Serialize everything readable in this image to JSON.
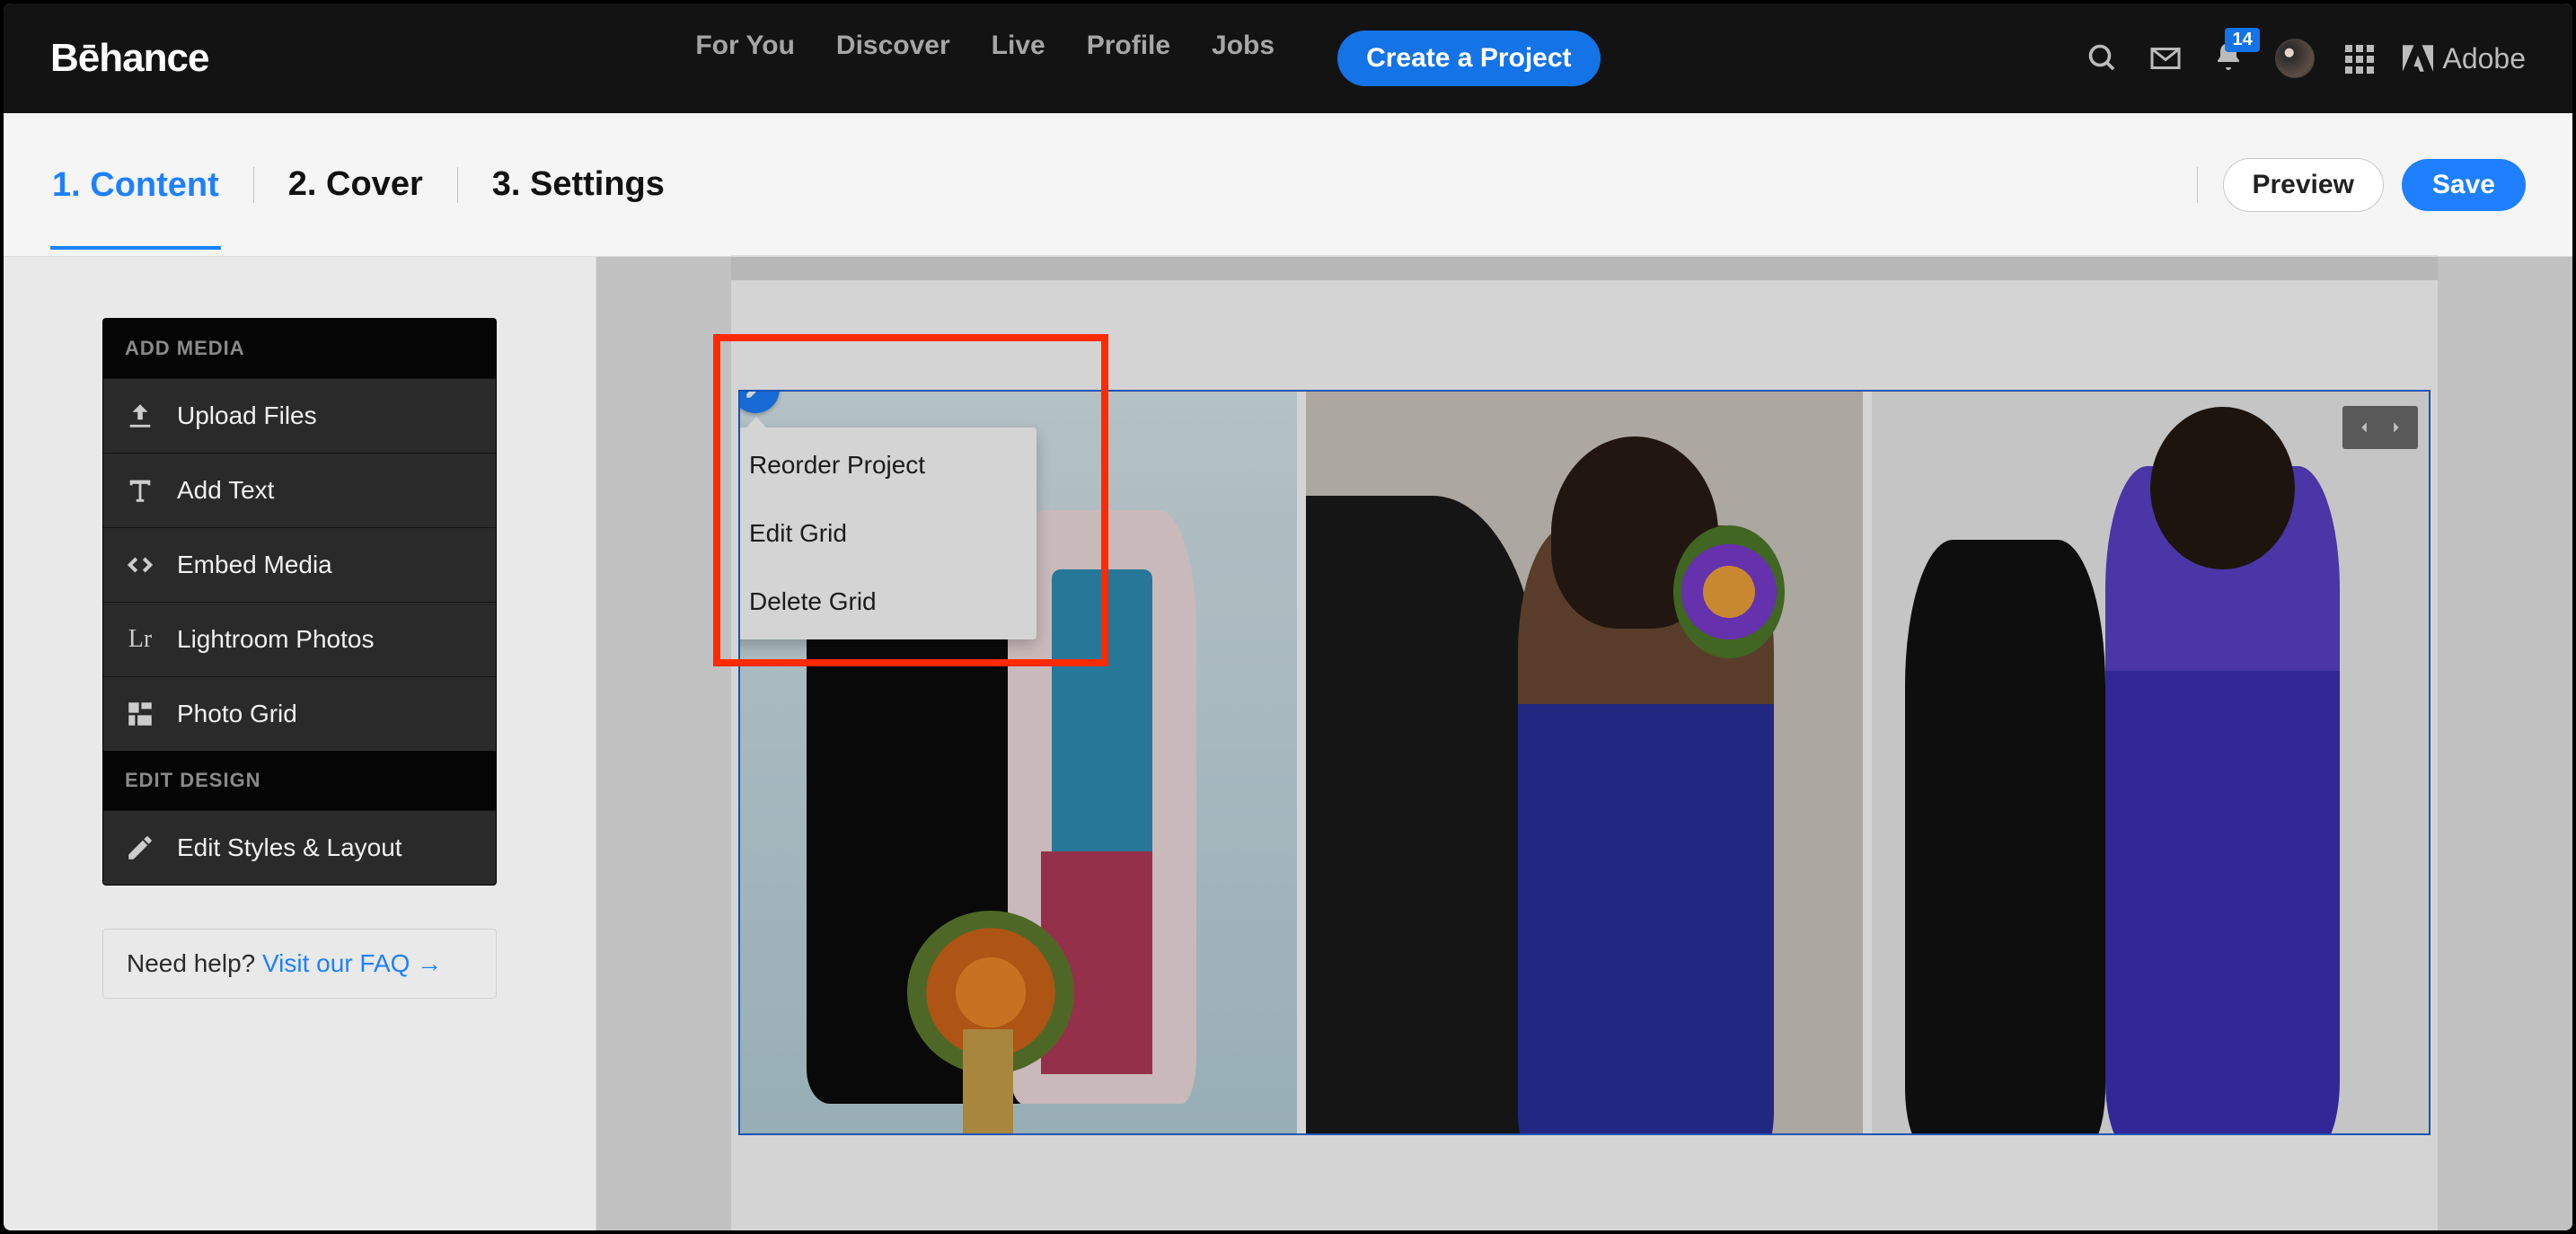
{
  "topnav": {
    "logo": "Bēhance",
    "links": [
      "For You",
      "Discover",
      "Live",
      "Profile",
      "Jobs"
    ],
    "create_label": "Create a Project",
    "badge_count": "14",
    "adobe_label": "Adobe"
  },
  "subbar": {
    "steps": [
      "1. Content",
      "2. Cover",
      "3. Settings"
    ],
    "active_index": 0,
    "preview_label": "Preview",
    "save_label": "Save"
  },
  "sidebar": {
    "heading_media": "ADD MEDIA",
    "items": [
      {
        "label": "Upload Files"
      },
      {
        "label": "Add Text"
      },
      {
        "label": "Embed Media"
      },
      {
        "label": "Lightroom Photos"
      },
      {
        "label": "Photo Grid"
      }
    ],
    "heading_design": "EDIT DESIGN",
    "design_items": [
      {
        "label": "Edit Styles & Layout"
      }
    ],
    "help_prefix": "Need help? ",
    "help_link": "Visit our FAQ →"
  },
  "popup": {
    "items": [
      "Reorder Project",
      "Edit Grid",
      "Delete Grid"
    ]
  }
}
